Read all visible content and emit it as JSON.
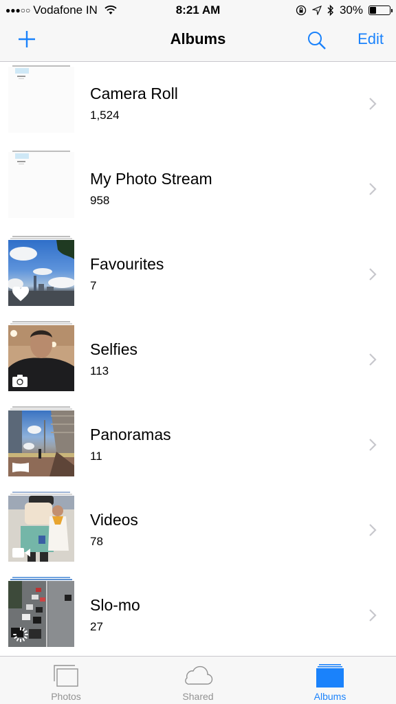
{
  "status_bar": {
    "signal": "●●●○○",
    "carrier": "Vodafone IN",
    "time": "8:21 AM",
    "battery_percent_label": "30%",
    "battery_level": 0.3
  },
  "nav": {
    "title": "Albums",
    "add_icon": "plus-icon",
    "search_icon": "search-icon",
    "edit_label": "Edit"
  },
  "albums": [
    {
      "name": "Camera Roll",
      "count": "1,524",
      "thumb": "document-screenshot",
      "overlay_icon": null
    },
    {
      "name": "My Photo Stream",
      "count": "958",
      "thumb": "document-screenshot",
      "overlay_icon": null
    },
    {
      "name": "Favourites",
      "count": "7",
      "thumb": "city-skyline",
      "overlay_icon": "heart-icon"
    },
    {
      "name": "Selfies",
      "count": "113",
      "thumb": "selfie",
      "overlay_icon": "front-camera-icon"
    },
    {
      "name": "Panoramas",
      "count": "11",
      "thumb": "street",
      "overlay_icon": "panorama-icon"
    },
    {
      "name": "Videos",
      "count": "78",
      "thumb": "mascot",
      "overlay_icon": "video-camera-icon"
    },
    {
      "name": "Slo-mo",
      "count": "27",
      "thumb": "traffic",
      "overlay_icon": "slomo-icon"
    }
  ],
  "tabs": [
    {
      "label": "Photos",
      "icon": "photos-icon",
      "active": false
    },
    {
      "label": "Shared",
      "icon": "cloud-icon",
      "active": false
    },
    {
      "label": "Albums",
      "icon": "albums-icon",
      "active": true
    }
  ],
  "colors": {
    "accent": "#1a82fb",
    "inactive_tab": "#929292",
    "chevron": "#c7c7cc"
  }
}
